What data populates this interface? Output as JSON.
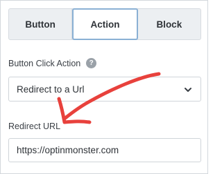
{
  "tabs": [
    {
      "label": "Button",
      "active": false
    },
    {
      "label": "Action",
      "active": true
    },
    {
      "label": "Block",
      "active": false
    }
  ],
  "click_action": {
    "label": "Button Click Action",
    "help_icon": "question-circle-icon",
    "selected": "Redirect to a Url",
    "chevron_icon": "chevron-down-icon"
  },
  "redirect_url": {
    "label": "Redirect URL",
    "value": "https://optinmonster.com"
  },
  "annotation": {
    "type": "red-hand-drawn-arrow",
    "color": "#e8413c"
  },
  "colors": {
    "active_tab_border": "#8ab0d4",
    "tab_bar_bg": "#eceff2",
    "border": "#cfd4d9"
  }
}
